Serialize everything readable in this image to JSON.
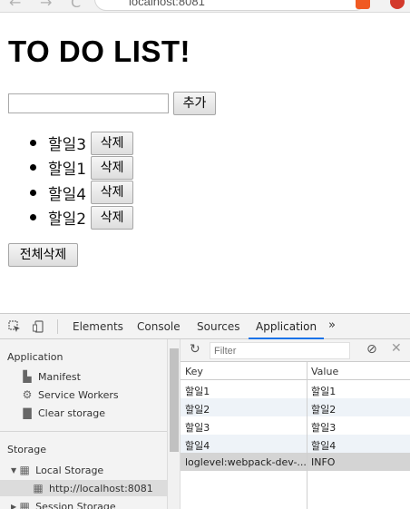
{
  "browser": {
    "url": "localhost:8081",
    "nav_back": "←",
    "nav_forward": "→",
    "nav_reload": "C"
  },
  "page": {
    "title": "TO DO LIST!",
    "input_value": "",
    "add_label": "추가",
    "todos": [
      {
        "text": "할일3",
        "delete_label": "삭제"
      },
      {
        "text": "할일1",
        "delete_label": "삭제"
      },
      {
        "text": "할일4",
        "delete_label": "삭제"
      },
      {
        "text": "할일2",
        "delete_label": "삭제"
      }
    ],
    "clear_all_label": "전체삭제"
  },
  "devtools": {
    "tabs": [
      "Elements",
      "Console",
      "Sources",
      "Application"
    ],
    "active_tab": "Application",
    "more_label": "»",
    "sidebar": {
      "application_header": "Application",
      "manifest": "Manifest",
      "service_workers": "Service Workers",
      "clear_storage": "Clear storage",
      "storage_header": "Storage",
      "local_storage": "Local Storage",
      "local_storage_origin": "http://localhost:8081",
      "session_storage": "Session Storage"
    },
    "toolbar": {
      "filter_placeholder": "Filter"
    },
    "table": {
      "headers": {
        "key": "Key",
        "value": "Value"
      },
      "rows": [
        {
          "key": "할일1",
          "value": "할일1"
        },
        {
          "key": "할일2",
          "value": "할일2"
        },
        {
          "key": "할일3",
          "value": "할일3"
        },
        {
          "key": "할일4",
          "value": "할일4"
        },
        {
          "key": "loglevel:webpack-dev-...",
          "value": "INFO"
        }
      ]
    }
  },
  "colors": {
    "active_tab_underline": "#1a73e8",
    "selected_row": "#d4d4d4",
    "alt_row": "#eef3f8"
  }
}
